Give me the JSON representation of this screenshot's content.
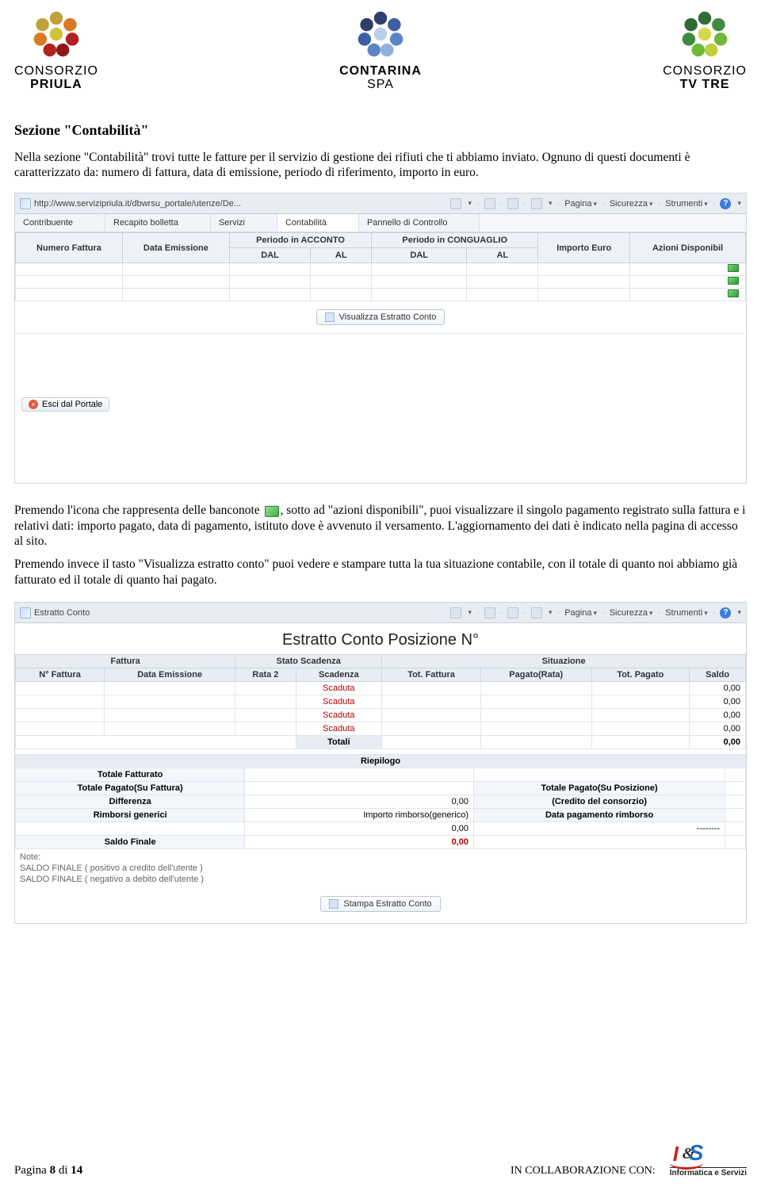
{
  "logos": {
    "left": {
      "line1": "CONSORZIO",
      "line2": "PRIULA"
    },
    "mid": {
      "line1": "CONTARINA",
      "line2": "SPA"
    },
    "right": {
      "line1": "CONSORZIO",
      "line2": "TV TRE"
    }
  },
  "section_title": "Sezione \"Contabilità\"",
  "para1": "Nella sezione \"Contabilità\" trovi tutte le fatture per il servizio di gestione dei rifiuti che ti abbiamo inviato. Ognuno di questi documenti è caratterizzato da: numero di fattura, data di emissione, periodo di riferimento, importo in euro.",
  "shot1": {
    "url": "http://www.servizipriula.it/dbwrsu_portale/utenze/De...",
    "toolbar": {
      "pagina": "Pagina",
      "sicurezza": "Sicurezza",
      "strumenti": "Strumenti"
    },
    "tabs": [
      "Contribuente",
      "Recapito bolletta",
      "Servizi",
      "Contabilità",
      "Pannello di Controllo"
    ],
    "active_tab_index": 3,
    "headers": {
      "num": "Numero Fattura",
      "emiss": "Data Emissione",
      "pacc": "Periodo in ACCONTO",
      "pcon": "Periodo in CONGUAGLIO",
      "dal": "DAL",
      "al": "AL",
      "imp": "Importo Euro",
      "azioni": "Azioni Disponibil"
    },
    "btn_visualizza": "Visualizza Estratto Conto",
    "btn_esci": "Esci dal Portale"
  },
  "para2_pre": "Premendo l'icona che rappresenta delle banconote ",
  "para2_post": ", sotto ad \"azioni disponibili\", puoi visualizzare il singolo pagamento registrato sulla fattura e i relativi dati: importo pagato, data di pagamento, istituto dove è avvenuto il versamento. L'aggiornamento dei dati è indicato nella pagina di accesso al sito.",
  "para3": "Premendo invece il tasto \"Visualizza estratto conto\" puoi vedere e stampare tutta la tua situazione contabile, con il totale di quanto noi abbiamo già fatturato ed il totale di quanto hai pagato.",
  "shot2": {
    "tabname": "Estratto Conto",
    "title": "Estratto Conto Posizione N°",
    "toolbar": {
      "pagina": "Pagina",
      "sicurezza": "Sicurezza",
      "strumenti": "Strumenti"
    },
    "group_headers": {
      "fatt": "Fattura",
      "stato": "Stato Scadenza",
      "sit": "Situazione"
    },
    "cols": {
      "nfatt": "N° Fattura",
      "demiss": "Data Emissione",
      "rata": "Rata 2",
      "scad": "Scadenza",
      "totf": "Tot. Fattura",
      "prata": "Pagato(Rata)",
      "totp": "Tot. Pagato",
      "saldo": "Saldo"
    },
    "scaduta": "Scaduta",
    "vals": {
      "v0": "0,00"
    },
    "totali": "Totali",
    "riepilogo": "Riepilogo",
    "rows": {
      "tf": "Totale Fatturato",
      "tps": "Totale Pagato(Su Fattura)",
      "tpp": "Totale Pagato(Su Posizione)",
      "diff": "Differenza",
      "cred": "(Credito del consorzio)",
      "rimb": "Rimborsi generici",
      "impr": "Importo rimborso(generico)",
      "dpr": "Data pagamento rimborso",
      "dash": "--------",
      "sf": "Saldo Finale"
    },
    "note_hdr": "Note:",
    "note1": "SALDO FINALE ( positivo a credito dell'utente )",
    "note2": "SALDO FINALE ( negativo a debito dell'utente )",
    "btn_stampa": "Stampa Estratto Conto"
  },
  "footer": {
    "page_pre": "Pagina ",
    "page_num": "8",
    "page_mid": " di ",
    "page_tot": "14",
    "collab": "IN COLLABORAZIONE CON:",
    "is_sub": "Informatica    e Servizi"
  }
}
